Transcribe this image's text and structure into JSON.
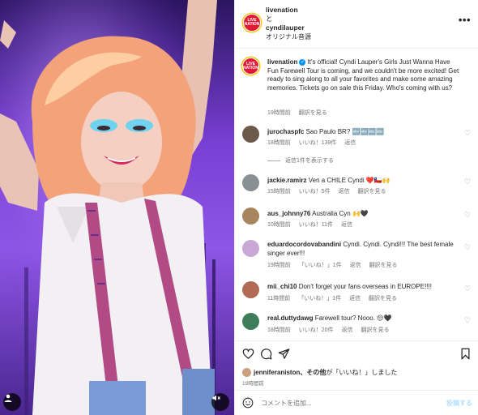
{
  "header": {
    "poster_username": "livenation",
    "connector": "と",
    "collaborator_username": "cyndilauper",
    "audio_label": "オリジナル音源",
    "more_icon": "more-horizontal-icon",
    "avatar_logo_text": "LIVE NATION"
  },
  "caption": {
    "username": "livenation",
    "verified": true,
    "text": "It's official! Cyndi Lauper's Girls Just Wanna Have Fun Farewell Tour is coming, and we couldn't be more excited! Get ready to sing along to all your favorites and make some amazing memories. Tickets go on sale this Friday. Who's coming with us?",
    "time": "19時間前",
    "translate": "翻訳を見る"
  },
  "comments": [
    {
      "username": "jurochaspfc",
      "text": "Sao Paulo BR? 🔤🔤🔤🔤",
      "time": "18時間前",
      "likes": "いいね！139件",
      "reply": "返信",
      "view_replies": "返信1件を表示する",
      "avatar_color": "#6b5a4a"
    },
    {
      "username": "jackie.ramirz",
      "text": "Ven a CHILE Cyndi ❤️🇨🇱🙌",
      "time": "15時間前",
      "likes": "いいね！5件",
      "reply": "返信",
      "translate": "翻訳を見る",
      "avatar_color": "#8a8f95"
    },
    {
      "username": "aus_johnny76",
      "text": "Australia Cyn 🙌🖤",
      "time": "10時間前",
      "likes": "いいね！11件",
      "reply": "返信",
      "avatar_color": "#a7855f"
    },
    {
      "username": "eduardocordovabandini",
      "text": "Cyndi. Cyndi. Cyndi!!! The best female singer ever!!!",
      "time": "19時間前",
      "likes": "「いいね！」1件",
      "reply": "返信",
      "translate": "翻訳を見る",
      "avatar_color": "#c9a7d6"
    },
    {
      "username": "mii_chi10",
      "text": "Don't forget your fans overseas in EUROPE!!!!",
      "time": "11時間前",
      "likes": "「いいね！」1件",
      "reply": "返信",
      "translate": "翻訳を見る",
      "avatar_color": "#b06a55"
    },
    {
      "username": "real.duttydawg",
      "text": "Farewell tour? Nooo. 😔🖤",
      "time": "18時間前",
      "likes": "いいね！20件",
      "reply": "返信",
      "translate": "翻訳を見る",
      "avatar_color": "#3f7d5a"
    }
  ],
  "actions": {
    "like_icon": "heart-icon",
    "comment_icon": "comment-icon",
    "share_icon": "send-icon",
    "save_icon": "bookmark-icon",
    "liked_by_user": "jenniferaniston",
    "liked_by_suffix_bold": "、その他",
    "liked_by_suffix": "が「いいね！」しました",
    "time": "19時間前"
  },
  "comment_box": {
    "emoji_icon": "smiley-icon",
    "placeholder": "コメントを追加...",
    "post_label": "投稿する"
  },
  "media": {
    "tag_icon": "user-tag-icon",
    "mute_icon": "muted-speaker-icon"
  }
}
